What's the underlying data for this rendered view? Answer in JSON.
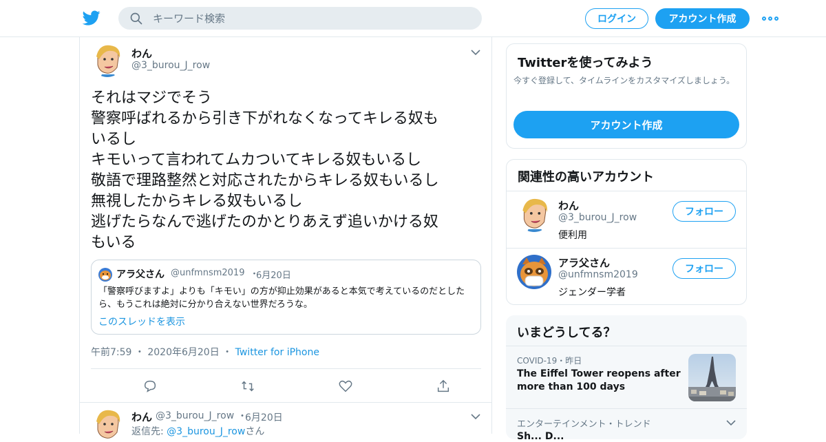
{
  "header": {
    "logo": "twitter-bird-icon",
    "search_placeholder": "キーワード検索",
    "login_label": "ログイン",
    "signup_label": "アカウント作成",
    "more_icon": "more-dots-icon"
  },
  "tweet": {
    "author_name": "わん",
    "author_handle": "@3_burou_J_row",
    "text_lines": [
      "それはマジでそう",
      "警察呼ばれるから引き下がれなくなってキレる奴も",
      "いるし",
      "キモいって言われてムカついてキレる奴もいるし",
      "敬語で理路整然と対応されたからキレる奴もいるし",
      "無視したからキレる奴もいるし",
      "逃げたらなんで逃げたのかとりあえず追いかける奴",
      "もいる"
    ],
    "quote": {
      "name": "アラ父さん",
      "handle": "@unfmnsm2019",
      "separator": "・",
      "date": "6月20日",
      "text": "「警察呼びますよ」よりも「キモい」の方が抑止効果があると本気で考えているのだとしたら、もうこれは絶対に分かり合えない世界だろうな。",
      "thread_link": "このスレッドを表示"
    },
    "time": "午前7:59",
    "date": "2020年6月20日",
    "separator": "・",
    "source": "Twitter for iPhone",
    "actions": [
      "reply-icon",
      "retweet-icon",
      "like-icon",
      "share-icon"
    ]
  },
  "reply_tweet": {
    "author_name": "わん",
    "author_handle": "@3_burou_J_row",
    "separator": "・",
    "date": "6月20日",
    "reply_prefix": "返信先: ",
    "reply_mention": "@3_burou_J_row",
    "reply_suffix": "さん"
  },
  "sidebar": {
    "signup_card": {
      "title": "Twitterを使ってみよう",
      "description": "今すぐ登録して、タイムラインをカスタマイズしましょう。",
      "button": "アカウント作成"
    },
    "related": {
      "title": "関連性の高いアカウント",
      "accounts": [
        {
          "name": "わん",
          "handle": "@3_burou_J_row",
          "bio": "便利用",
          "follow": "フォロー"
        },
        {
          "name": "アラ父さん",
          "handle": "@unfmnsm2019",
          "bio": "ジェンダー学者",
          "follow": "フォロー"
        }
      ]
    },
    "trends": {
      "title": "いまどうしてる？",
      "items": [
        {
          "category": "COVID-19・昨日",
          "headline": "The Eiffel Tower reopens after more than 100 days"
        },
        {
          "category": "エンターテインメント・トレンド",
          "name": "Sh... D..."
        }
      ]
    }
  }
}
